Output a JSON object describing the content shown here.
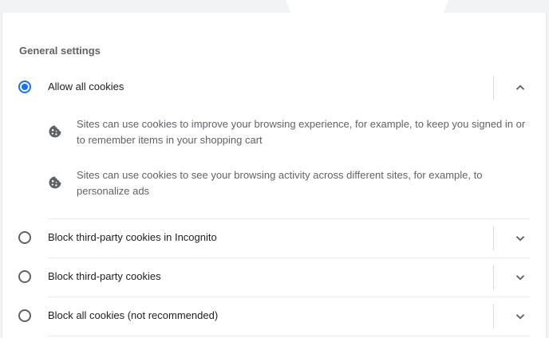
{
  "section": {
    "title": "General settings"
  },
  "options": [
    {
      "label": "Allow all cookies",
      "selected": true,
      "expanded": true,
      "icon": "chevron-up-icon"
    },
    {
      "label": "Block third-party cookies in Incognito",
      "selected": false,
      "expanded": false,
      "icon": "chevron-down-icon"
    },
    {
      "label": "Block third-party cookies",
      "selected": false,
      "expanded": false,
      "icon": "chevron-down-icon"
    },
    {
      "label": "Block all cookies (not recommended)",
      "selected": false,
      "expanded": false,
      "icon": "chevron-down-icon"
    }
  ],
  "allow_all_details": [
    {
      "icon": "cookie-icon",
      "text": "Sites can use cookies to improve your browsing experience, for example, to keep you signed in or to remember items in your shopping cart"
    },
    {
      "icon": "cookie-icon",
      "text": "Sites can use cookies to see your browsing activity across different sites, for example, to personalize ads"
    }
  ],
  "colors": {
    "accent": "#1a73e8",
    "text_primary": "#202124",
    "text_secondary": "#5f6368",
    "divider": "#e8eaed",
    "background": "#f1f3f4"
  }
}
